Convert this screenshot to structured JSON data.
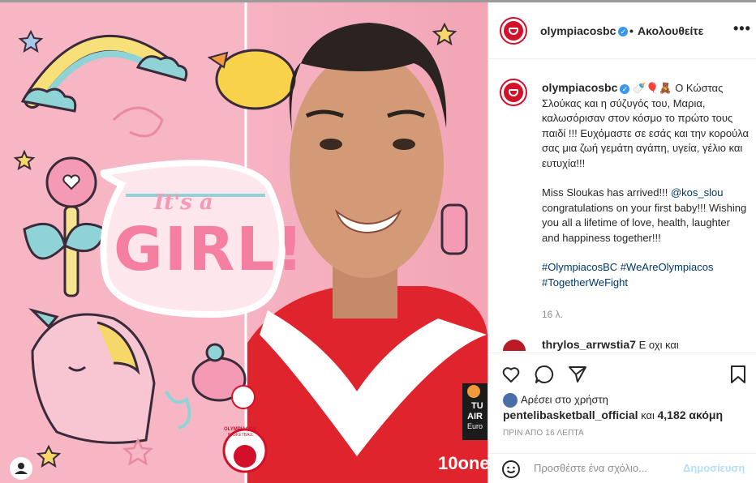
{
  "post": {
    "username": "olympiacosbc",
    "separator": "•",
    "follow_label": "Ακολουθείτε",
    "more": "•••"
  },
  "image": {
    "sticker_top": "It's a",
    "sticker_main": "GIRL!",
    "jersey_brand": "OLYMPIACOS",
    "jersey_sub": "BASKETBALL",
    "sponsor": "10one",
    "euro_top": "TU",
    "euro_mid": "AIR",
    "euro_bottom": "Euro"
  },
  "caption": {
    "username": "olympiacosbc",
    "emojis": "🍼🎈🧸",
    "greek": "Ο Κώστας Σλούκας και η σύζυγός του, Μαρια, καλωσόρισαν στον κόσμο το πρώτο τους παιδί !!! Ευχόμαστε σε εσάς και την κορούλα σας μια ζωή γεμάτη αγάπη, υγεία, γέλιο και ευτυχία!!!",
    "english_start": "Miss Sloukas has arrived!!! ",
    "mention": "@kos_slou",
    "english_rest": " congratulations on your first baby!!! Wishing you all a lifetime of love, health, laughter and happiness together!!!",
    "hashtags": "#OlympiacosBC #WeAreOlympiacos #TogetherWeFight",
    "time": "16 λ."
  },
  "comment": {
    "username": "thrylos_arrwstia7",
    "text": "Ε οχι και"
  },
  "likes": {
    "liked_by_prefix": "Αρέσει στο χρήστη",
    "liked_user": "pentelibasketball_official",
    "and": "και",
    "count": "4,182 ακόμη"
  },
  "post_time": "ΠΡΙΝ ΑΠΟ 16 ΛΕΠΤΑ",
  "add_comment": {
    "placeholder": "Προσθέστε ένα σχόλιο...",
    "post_label": "Δημοσίευση"
  },
  "colors": {
    "brand_red": "#d3102a",
    "link": "#00376b",
    "verified": "#3897f0",
    "post_disabled": "#b2dffc",
    "pink_bg": "#f4a8b8"
  },
  "icons": [
    "heart-icon",
    "comment-icon",
    "share-icon",
    "bookmark-icon",
    "smile-icon",
    "more-icon",
    "verified-icon",
    "profile-icon"
  ]
}
